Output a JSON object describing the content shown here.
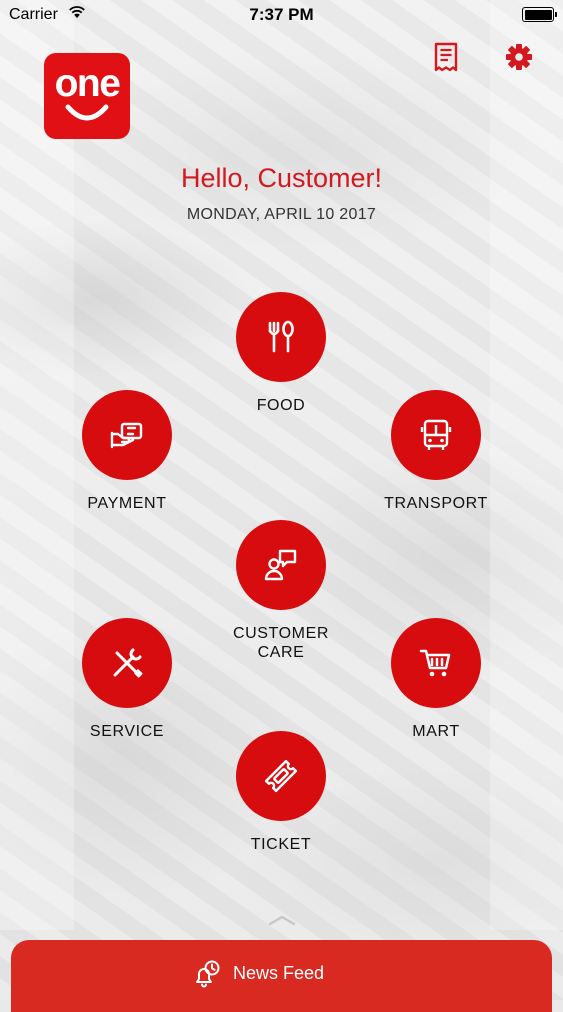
{
  "status_bar": {
    "carrier": "Carrier",
    "time": "7:37 PM"
  },
  "header": {
    "logo_text": "one",
    "greeting": "Hello, Customer!",
    "date": "MONDAY, APRIL 10 2017"
  },
  "colors": {
    "brand": "#d70c0f",
    "greeting": "#d3191f",
    "news_bar": "#d92a22"
  },
  "icons": {
    "top_left": "receipt-icon",
    "top_right": "gear-icon"
  },
  "menu": {
    "food": "FOOD",
    "payment": "PAYMENT",
    "transport": "TRANSPORT",
    "customer_care_line1": "CUSTOMER",
    "customer_care_line2": "CARE",
    "service": "SERVICE",
    "mart": "MART",
    "ticket": "TICKET"
  },
  "news_feed": {
    "label": "News Feed"
  }
}
